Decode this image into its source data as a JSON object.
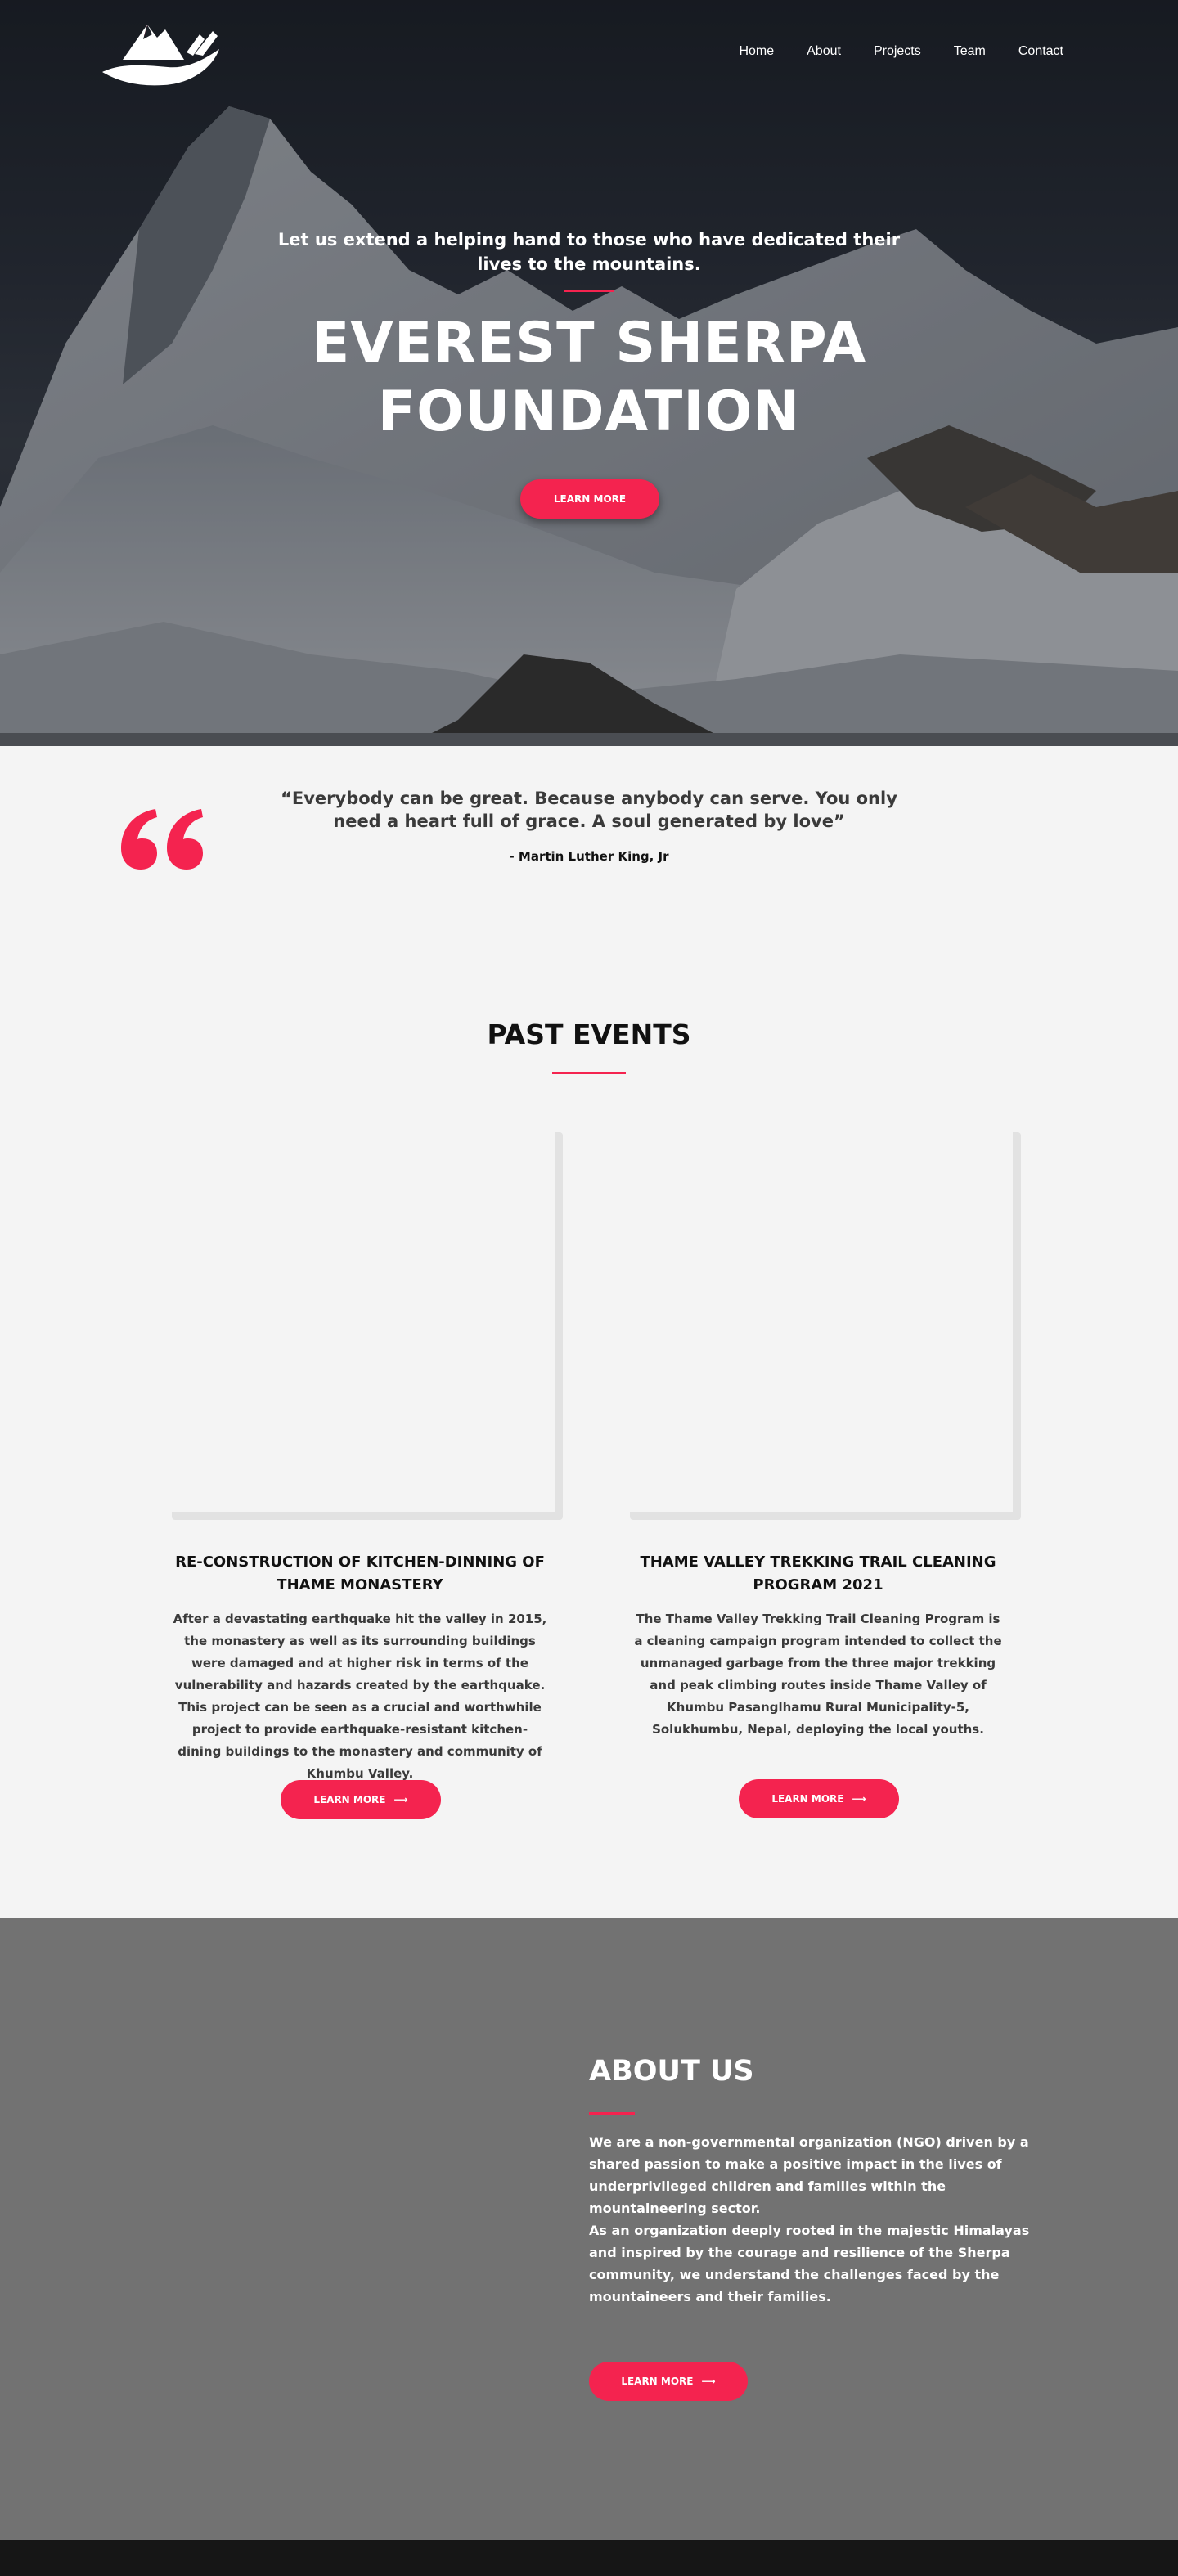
{
  "nav": {
    "items": [
      "Home",
      "About",
      "Projects",
      "Team",
      "Contact"
    ]
  },
  "hero": {
    "subtitle": "Let us extend a helping hand to those who have dedicated their lives to the mountains.",
    "title": "EVEREST SHERPA FOUNDATION",
    "button_label": "LEARN MORE"
  },
  "quote": {
    "text": "“Everybody can be great. Because anybody can serve. You only need a heart full of grace. A soul generated by love”",
    "author": "- Martin Luther King, Jr"
  },
  "events": {
    "title": "PAST EVENTS",
    "cards": [
      {
        "title": "RE-CONSTRUCTION OF KITCHEN-DINNING OF THAME MONASTERY",
        "description": "After a devastating earthquake hit the valley in 2015, the monastery as well as its surrounding buildings were damaged and at higher risk in terms of the vulnerability and hazards created by the earthquake. This project can be seen as a crucial and worthwhile project to provide earthquake-resistant kitchen-dining buildings to the monastery and community of Khumbu Valley.",
        "button_label": "LEARN MORE"
      },
      {
        "title": "THAME VALLEY TREKKING TRAIL CLEANING PROGRAM 2021",
        "description": "The Thame Valley Trekking Trail Cleaning Program is a cleaning campaign program intended to collect the unmanaged garbage from the three major trekking and peak climbing routes inside Thame Valley of Khumbu Pasanglhamu Rural Municipality-5, Solukhumbu, Nepal, deploying the local youths.",
        "button_label": "LEARN MORE"
      }
    ]
  },
  "about": {
    "title": "ABOUT US",
    "paragraphs": [
      "We are a non-governmental organization (NGO) driven by a shared passion to make a positive impact in the lives of underprivileged children and families within the mountaineering sector.",
      "As an organization deeply rooted in the majestic Himalayas and inspired by the courage and resilience of the Sherpa community, we understand the challenges faced by the mountaineers and their families."
    ],
    "button_label": "LEARN MORE"
  },
  "colors": {
    "accent": "#f4234f",
    "about_bg": "#727272",
    "page_bg": "#f4f4f4",
    "footer_bg": "#161616"
  },
  "icons": {
    "logo": "mountain-hand-logo",
    "quote": "quote-icon",
    "arrow": "arrow-right-icon"
  }
}
